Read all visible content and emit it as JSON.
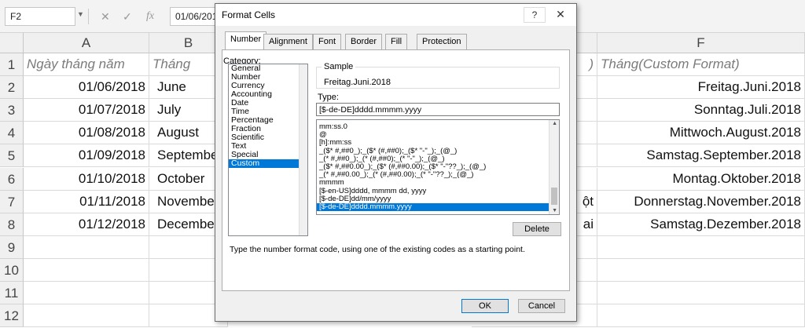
{
  "formula_bar": {
    "name_box": "F2",
    "cancel_icon": "✕",
    "enter_icon": "✓",
    "fx": "fx",
    "formula": "01/06/2018"
  },
  "grid": {
    "columns": [
      {
        "letter": "A"
      },
      {
        "letter": "B"
      },
      {
        "letter": "F"
      }
    ],
    "rows": [
      "1",
      "2",
      "3",
      "4",
      "5",
      "6",
      "7",
      "8",
      "9",
      "10",
      "11",
      "12"
    ],
    "header_row": {
      "a": "Ngày tháng năm",
      "b": "Tháng",
      "f": "Tháng(Custom Format)",
      "e_fragment": ")"
    },
    "data": [
      {
        "a": "01/06/2018",
        "b": "June",
        "e": "",
        "f": "Freitag.Juni.2018"
      },
      {
        "a": "01/07/2018",
        "b": "July",
        "e": "",
        "f": "Sonntag.Juli.2018"
      },
      {
        "a": "01/08/2018",
        "b": "August",
        "e": "",
        "f": "Mittwoch.August.2018"
      },
      {
        "a": "01/09/2018",
        "b": "September",
        "e": "",
        "f": "Samstag.September.2018"
      },
      {
        "a": "01/10/2018",
        "b": "October",
        "e": "",
        "f": "Montag.Oktober.2018"
      },
      {
        "a": "01/11/2018",
        "b": "November",
        "e": "ột",
        "f": "Donnerstag.November.2018"
      },
      {
        "a": "01/12/2018",
        "b": "December",
        "e": "ai",
        "f": "Samstag.Dezember.2018"
      }
    ]
  },
  "dialog": {
    "title": "Format Cells",
    "help": "?",
    "close": "✕",
    "tabs": [
      "Number",
      "Alignment",
      "Font",
      "Border",
      "Fill",
      "Protection"
    ],
    "category_label": "Category:",
    "categories": [
      "General",
      "Number",
      "Currency",
      "Accounting",
      "Date",
      "Time",
      "Percentage",
      "Fraction",
      "Scientific",
      "Text",
      "Special",
      "Custom"
    ],
    "selected_category": "Custom",
    "sample_label": "Sample",
    "sample_value": "Freitag.Juni.2018",
    "type_label": "Type:",
    "type_value": "[$-de-DE]dddd.mmmm.yyyy",
    "formats": [
      "mm:ss.0",
      "@",
      "[h]:mm:ss",
      "_($* #,##0_);_($* (#,##0);_($* \"-\"_);_(@_)",
      "_(* #,##0_);_(* (#,##0);_(* \"-\"_);_(@_)",
      "_($* #,##0.00_);_($* (#,##0.00);_($* \"-\"??_);_(@_)",
      "_(* #,##0.00_);_(* (#,##0.00);_(* \"-\"??_);_(@_)",
      "mmmm",
      "[$-en-US]dddd, mmmm dd, yyyy",
      "[$-de-DE]dd/mm/yyyy",
      "[$-de-DE]dddd.mmmm.yyyy"
    ],
    "delete_label": "Delete",
    "hint": "Type the number format code, using one of the existing codes as a starting point.",
    "ok_label": "OK",
    "cancel_label": "Cancel",
    "colors": {
      "selection": "#0078d7"
    }
  }
}
